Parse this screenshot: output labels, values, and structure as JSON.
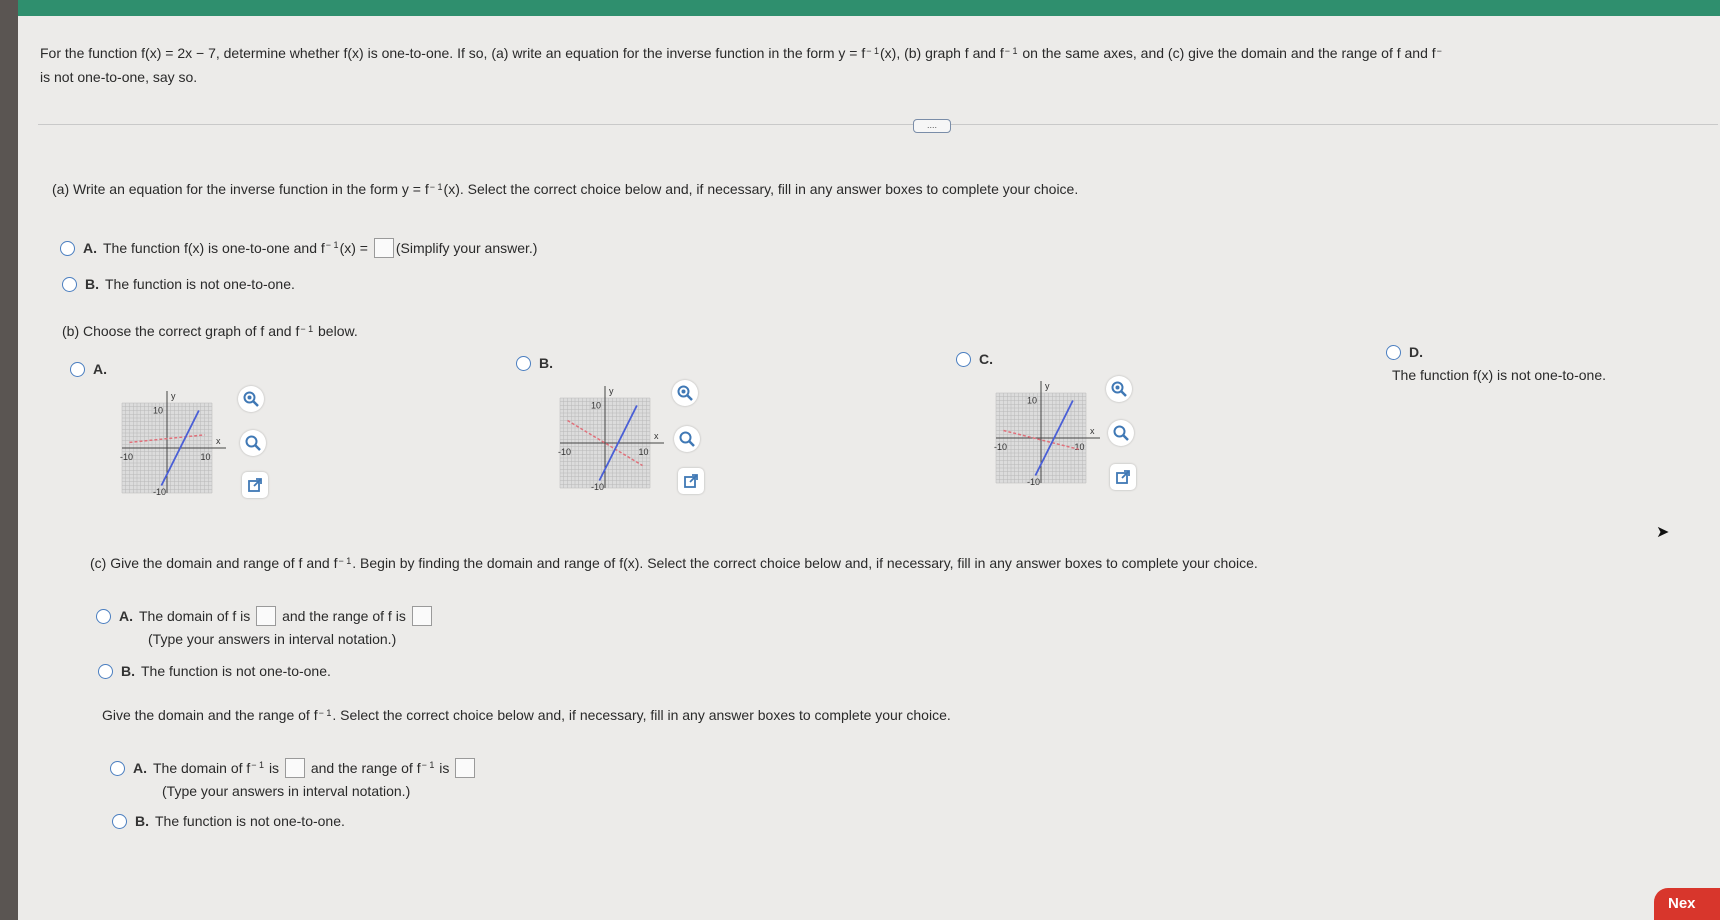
{
  "question": {
    "line1_a": "For the function f(x) = 2x − 7, determine whether f(x) is one-to-one. If so, (a) write an equation for the inverse function in the form y = f",
    "sup": "− 1",
    "line1_b": "(x), (b) graph f and f",
    "line1_c": "on the same axes, and (c) give the domain and the range of f and f",
    "line1_sup_end": "−",
    "line2": "is not one-to-one, say so."
  },
  "expander_label": "....",
  "part_a": {
    "prompt_a": "(a) Write an equation for the inverse function in the form y = f",
    "prompt_b": "(x). Select the correct choice below and, if necessary, fill in any answer boxes to complete your choice.",
    "opt_a_letter": "A.",
    "opt_a_text1": "The function f(x) is one-to-one and f",
    "opt_a_text2": "(x) =",
    "opt_a_text3": "(Simplify your answer.)",
    "opt_b_letter": "B.",
    "opt_b_text": "The function is not one-to-one."
  },
  "part_b": {
    "prompt_a": "(b) Choose the correct graph of f and f",
    "prompt_b": "below.",
    "options": [
      {
        "letter": "A."
      },
      {
        "letter": "B."
      },
      {
        "letter": "C."
      },
      {
        "letter": "D.",
        "text": "The function f(x) is not one-to-one."
      }
    ],
    "graph_labels": {
      "y": "y",
      "x": "x",
      "top": "10",
      "left": "-10",
      "right": "10",
      "bottom": "-10"
    },
    "colors": {
      "f": "#4a5fd6",
      "finv": "#e0707a",
      "grid": "#b8b8b8"
    }
  },
  "part_c": {
    "prompt_a": "(c) Give the domain and range of f and f",
    "prompt_b": ". Begin by finding the domain and range of f(x). Select the correct choice below and, if necessary, fill in any answer boxes to complete your choice.",
    "opt_a_letter": "A.",
    "opt_a_text1": "The domain of f is",
    "opt_a_text2": "and the range of f is",
    "opt_a_hint": "(Type your answers in interval notation.)",
    "opt_b_letter": "B.",
    "opt_b_text": "The function is not one-to-one.",
    "prompt2_a": "Give the domain and the range of f",
    "prompt2_b": ". Select the correct choice below and, if necessary, fill in any answer boxes to complete your choice.",
    "opt2_a_letter": "A.",
    "opt2_a_text1": "The domain of f",
    "opt2_a_text2": "is",
    "opt2_a_text3": "and the range of f",
    "opt2_a_text4": "is",
    "opt2_a_hint": "(Type your answers in interval notation.)",
    "opt2_b_letter": "B.",
    "opt2_b_text": "The function is not one-to-one."
  },
  "next_label": "Nex",
  "icons": [
    "zoom-in-icon",
    "zoom-out-icon",
    "popout-icon"
  ]
}
